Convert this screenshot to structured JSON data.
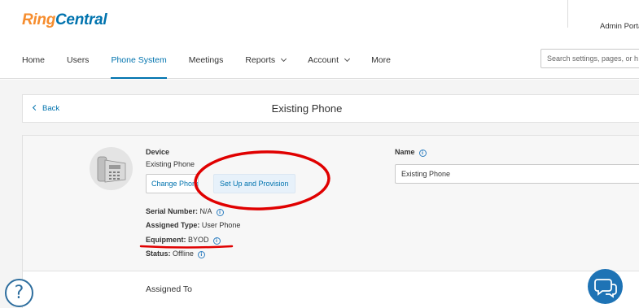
{
  "header": {
    "logo_ring": "Ring",
    "logo_central": "Central",
    "admin_link": "Admin Porta",
    "search_placeholder": "Search settings, pages, or h"
  },
  "nav": {
    "items": [
      {
        "label": "Home"
      },
      {
        "label": "Users"
      },
      {
        "label": "Phone System"
      },
      {
        "label": "Meetings"
      },
      {
        "label": "Reports"
      },
      {
        "label": "Account"
      },
      {
        "label": "More"
      }
    ],
    "active": "Phone System"
  },
  "page": {
    "back_label": "Back",
    "title": "Existing Phone"
  },
  "device": {
    "section_label": "Device",
    "device_name": "Existing Phone",
    "change_button": "Change Phone",
    "setup_button": "Set Up and Provision",
    "serial_label": "Serial Number:",
    "serial_value": "N/A",
    "assigned_type_label": "Assigned Type:",
    "assigned_type_value": "User Phone",
    "equipment_label": "Equipment:",
    "equipment_value": "BYOD",
    "status_label": "Status:",
    "status_value": "Offline"
  },
  "name": {
    "label": "Name",
    "value": "Existing Phone"
  },
  "assigned_to": {
    "label": "Assigned To"
  },
  "icons": {
    "help": "help-circle-icon",
    "chat": "chat-bubble-icon",
    "info": "info-icon",
    "back": "chevron-left-icon",
    "dropdown": "chevron-down-icon"
  },
  "colors": {
    "brand_orange": "#f68d2e",
    "brand_blue": "#0073ae",
    "annotation_red": "#e00000",
    "chat_button": "#1e73b5"
  }
}
